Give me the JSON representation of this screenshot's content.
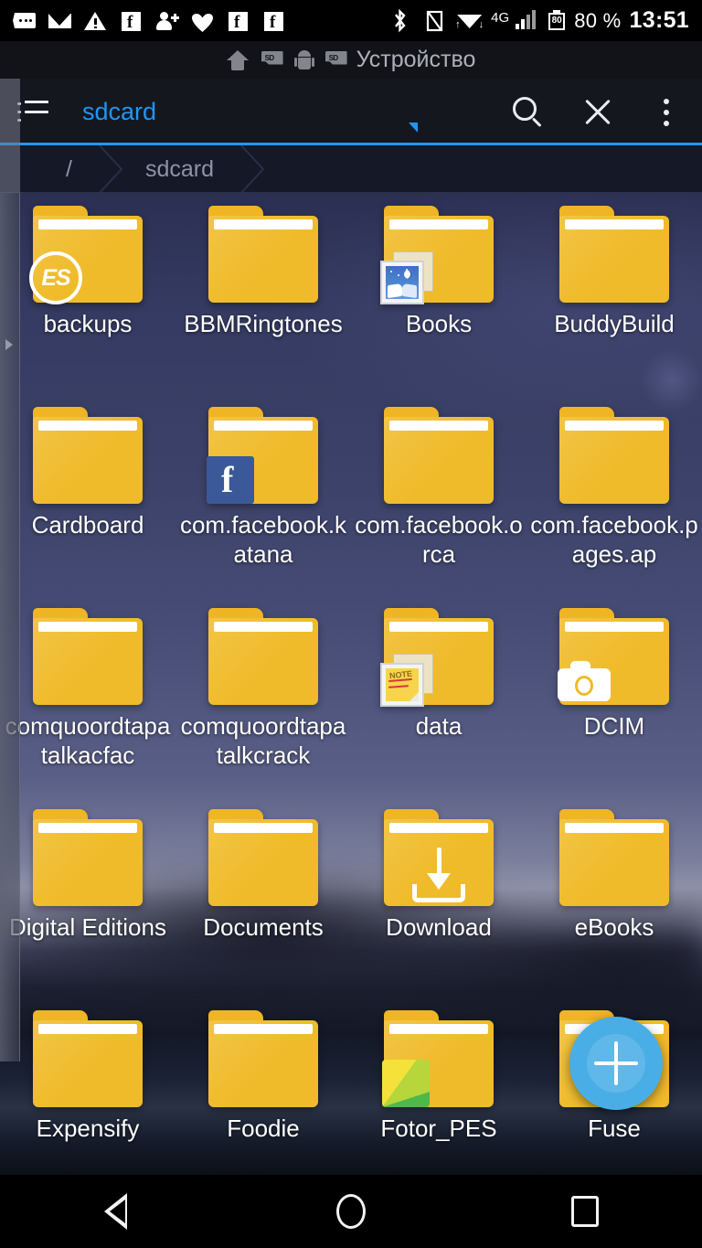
{
  "status_bar": {
    "left_icons": [
      {
        "name": "sms-icon",
        "glyph": "message-bubble"
      },
      {
        "name": "email-icon",
        "glyph": "envelope"
      },
      {
        "name": "warning-icon",
        "glyph": "alert-triangle"
      },
      {
        "name": "facebook-notification-icon",
        "glyph": "facebook-square"
      },
      {
        "name": "friend-request-icon",
        "glyph": "person-add"
      },
      {
        "name": "health-icon",
        "glyph": "heart"
      },
      {
        "name": "facebook-notification-icon-2",
        "glyph": "facebook-square"
      },
      {
        "name": "facebook-notification-icon-3",
        "glyph": "facebook-square"
      }
    ],
    "bluetooth_icon": "bluetooth-icon",
    "nfc_icon": "nfc-icon",
    "wifi_icon": "wifi-icon",
    "network_type": "4G",
    "signal_icon": "signal-bars-icon",
    "battery_level_number": "80",
    "battery_percent": "80 %",
    "clock": "13:51"
  },
  "device_bar": {
    "home_icon": "home-icon",
    "sdcard_icon": "sdcard-icon",
    "android_icon": "android-icon",
    "label_icon": "sdcard-icon",
    "label": "Устройство"
  },
  "toolbar": {
    "menu_icon": "list-menu-icon",
    "tab_label": "sdcard",
    "search_icon": "search-icon",
    "close_icon": "close-icon",
    "overflow_icon": "overflow-menu-icon",
    "accent_color": "#2196f3"
  },
  "breadcrumb": {
    "items": [
      {
        "label": "/"
      },
      {
        "label": "sdcard"
      }
    ]
  },
  "files": [
    {
      "name": "backups",
      "badge": "es-logo"
    },
    {
      "name": "BBMRingtones",
      "badge": "none"
    },
    {
      "name": "Books",
      "badge": "image-thumbnail"
    },
    {
      "name": "BuddyBuild",
      "badge": "none"
    },
    {
      "name": "Cardboard",
      "badge": "none"
    },
    {
      "name": "com.facebook.katana",
      "badge": "facebook"
    },
    {
      "name": "com.facebook.orca",
      "badge": "none"
    },
    {
      "name": "com.facebook.pages.ap",
      "badge": "none"
    },
    {
      "name": "comquoordtapatalkacfac",
      "badge": "none"
    },
    {
      "name": "comquoordtapatalkcrack",
      "badge": "none"
    },
    {
      "name": "data",
      "badge": "note-thumbnail"
    },
    {
      "name": "DCIM",
      "badge": "camera"
    },
    {
      "name": "Digital Editions",
      "badge": "none"
    },
    {
      "name": "Documents",
      "badge": "none"
    },
    {
      "name": "Download",
      "badge": "download-arrow"
    },
    {
      "name": "eBooks",
      "badge": "none"
    },
    {
      "name": "Expensify",
      "badge": "none"
    },
    {
      "name": "Foodie",
      "badge": "none"
    },
    {
      "name": "Fotor_PES",
      "badge": "color-pinwheel"
    },
    {
      "name": "Fuse",
      "badge": "none"
    }
  ],
  "fab": {
    "icon": "plus-icon",
    "color": "#4aaee6"
  },
  "nav_bar": {
    "back_icon": "back-triangle-icon",
    "home_icon": "home-circle-icon",
    "recents_icon": "recents-square-icon"
  },
  "colors": {
    "folder": "#f0bb2a",
    "accent": "#2196f3",
    "toolbar_bg": "#14171e",
    "breadcrumb_bg": "#141827"
  }
}
